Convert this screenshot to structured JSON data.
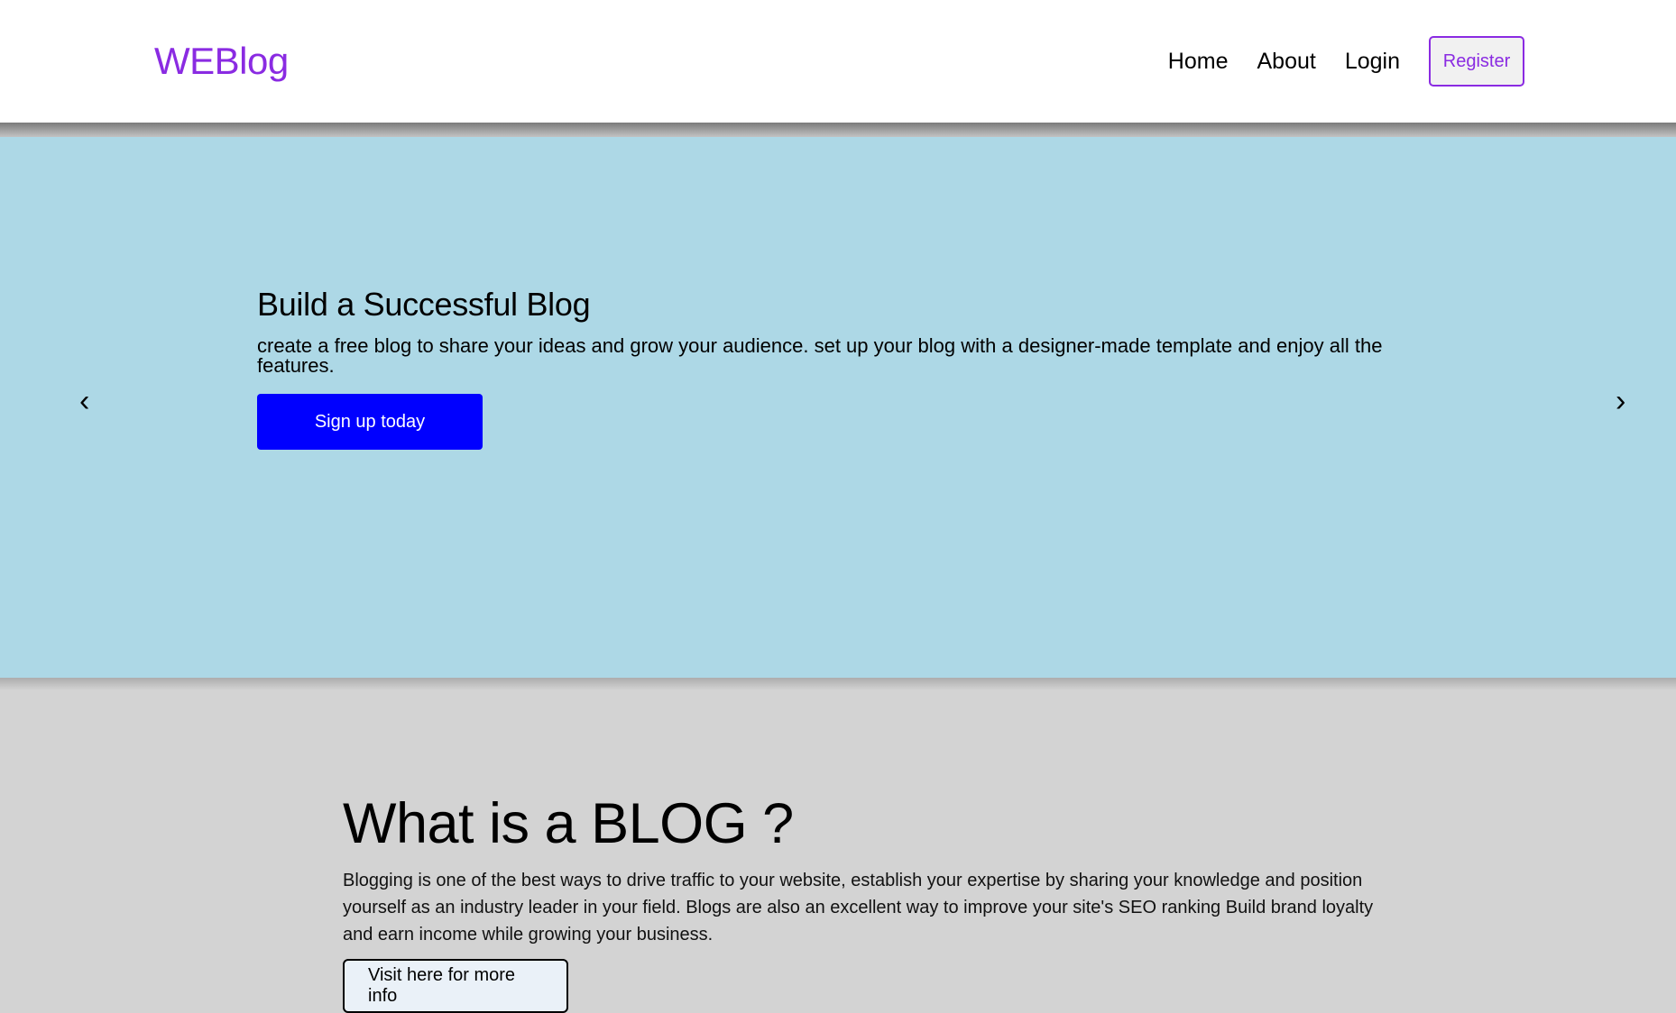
{
  "header": {
    "logo": "WEBlog",
    "nav": {
      "home": "Home",
      "about": "About",
      "login": "Login",
      "register": "Register"
    }
  },
  "hero": {
    "title": "Build a Successful Blog",
    "text": "create a free blog to share your ideas and grow your audience. set up your blog with a designer-made template and enjoy all the features.",
    "cta": "Sign up today",
    "prev": "‹",
    "next": "›"
  },
  "about": {
    "title": "What is a BLOG ?",
    "text": "Blogging is one of the best ways to drive traffic to your website, establish your expertise by sharing your knowledge and position yourself as an industry leader in your field. Blogs are also an excellent way to improve your site's SEO ranking Build brand loyalty and earn income while growing your business.",
    "button": "Visit here for more info"
  },
  "colors": {
    "brand": "#8a2be2",
    "hero_bg": "#add8e6",
    "cta_bg": "#0000ff",
    "page_bg": "#d3d3d3"
  }
}
